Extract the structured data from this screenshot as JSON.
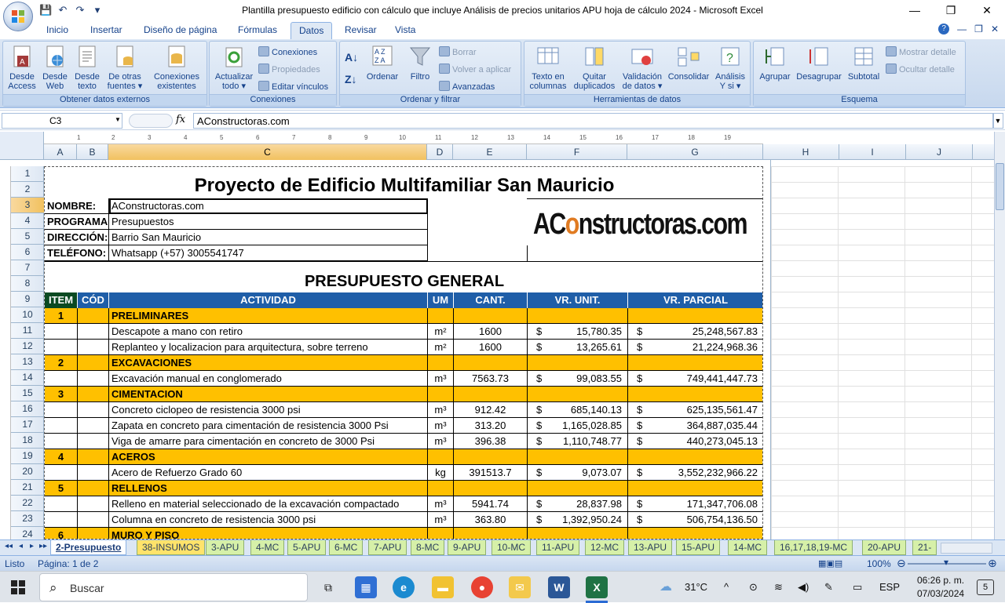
{
  "window": {
    "title": "Plantilla presupuesto edificio con cálculo que incluye Análisis de precios unitarios APU  hoja de cálculo 2024 - Microsoft Excel",
    "minimize": "—",
    "maximize": "❐",
    "close": "✕"
  },
  "qat": {
    "save": "💾",
    "undo": "↶",
    "redo": "↷",
    "more": "▾"
  },
  "tabs": [
    "Inicio",
    "Insertar",
    "Diseño de página",
    "Fórmulas",
    "Datos",
    "Revisar",
    "Vista"
  ],
  "tab_right": {
    "help": "?",
    "min": "—",
    "restore": "❐",
    "close": "✕"
  },
  "ribbon": {
    "g1": {
      "label": "Obtener datos externos",
      "b1": "Desde Access",
      "b1a": "Desde",
      "b1b": "Access",
      "b2a": "Desde",
      "b2b": "Web",
      "b3a": "Desde",
      "b3b": "texto",
      "b4a": "De otras",
      "b4b": "fuentes ▾",
      "b5a": "Conexiones",
      "b5b": "existentes"
    },
    "g2": {
      "label": "Conexiones",
      "b1a": "Actualizar",
      "b1b": "todo ▾",
      "s1": "Conexiones",
      "s2": "Propiedades",
      "s3": "Editar vínculos"
    },
    "g3": {
      "label": "Ordenar y filtrar",
      "b1": "Ordenar",
      "b2": "Filtro",
      "s1": "Borrar",
      "s2": "Volver a aplicar",
      "s3": "Avanzadas"
    },
    "g4": {
      "label": "Herramientas de datos",
      "b1a": "Texto en",
      "b1b": "columnas",
      "b2a": "Quitar",
      "b2b": "duplicados",
      "b3a": "Validación",
      "b3b": "de datos ▾",
      "b4": "Consolidar",
      "b5a": "Análisis",
      "b5b": "Y si ▾"
    },
    "g5": {
      "label": "Esquema",
      "b1": "Agrupar",
      "b2": "Desagrupar",
      "b3": "Subtotal",
      "s1": "Mostrar detalle",
      "s2": "Ocultar detalle"
    }
  },
  "formula": {
    "namebox": "C3",
    "fx": "fx",
    "content": "AConstructoras.com"
  },
  "columns": [
    "A",
    "B",
    "C",
    "D",
    "E",
    "F",
    "G",
    "H",
    "I",
    "J"
  ],
  "ruler": [
    "1",
    "2",
    "3",
    "4",
    "5",
    "6",
    "7",
    "8",
    "9",
    "10",
    "11",
    "12",
    "13",
    "14",
    "15",
    "16",
    "17",
    "18",
    "19"
  ],
  "rows": [
    "1",
    "2",
    "3",
    "4",
    "5",
    "6",
    "7",
    "8",
    "9",
    "10",
    "11",
    "12",
    "13",
    "14",
    "15",
    "16",
    "17",
    "18",
    "19",
    "20",
    "21",
    "22",
    "23",
    "24"
  ],
  "sheet": {
    "title": "Proyecto de Edificio Multifamiliar San Mauricio",
    "info": [
      {
        "label": "NOMBRE:",
        "value": "AConstructoras.com"
      },
      {
        "label": "PROGRAMA:",
        "value": "Presupuestos"
      },
      {
        "label": "DIRECCIÓN:",
        "value": "Barrio San Mauricio"
      },
      {
        "label": "TELÉFONO:",
        "value": "Whatsapp (+57) 3005541747"
      }
    ],
    "logo_a": "AC",
    "logo_b": "o",
    "logo_c": "nstructoras.com",
    "subtitle": "PRESUPUESTO GENERAL",
    "headers": [
      "ITEM",
      "CÓD",
      "ACTIVIDAD",
      "UM",
      "CANT.",
      "VR. UNIT.",
      "VR. PARCIAL"
    ],
    "lines": [
      {
        "type": "cat",
        "item": "1",
        "act": "PRELIMINARES"
      },
      {
        "type": "row",
        "act": "Descapote a mano con retiro",
        "um": "m²",
        "cant": "1600",
        "cur1": "$",
        "unit": "15,780.35",
        "cur2": "$",
        "parcial": "25,248,567.83"
      },
      {
        "type": "row",
        "act": " Replanteo y localizacion para arquitectura, sobre terreno",
        "um": "m²",
        "cant": "1600",
        "cur1": "$",
        "unit": "13,265.61",
        "cur2": "$",
        "parcial": "21,224,968.36"
      },
      {
        "type": "cat",
        "item": "2",
        "act": "EXCAVACIONES"
      },
      {
        "type": "row",
        "act": "Excavación manual en conglomerado",
        "um": "m³",
        "cant": "7563.73",
        "cur1": "$",
        "unit": "99,083.55",
        "cur2": "$",
        "parcial": "749,441,447.73"
      },
      {
        "type": "cat",
        "item": "3",
        "act": "CIMENTACION"
      },
      {
        "type": "row",
        "act": "Concreto ciclopeo de resistencia 3000 psi",
        "um": "m³",
        "cant": "912.42",
        "cur1": "$",
        "unit": "685,140.13",
        "cur2": "$",
        "parcial": "625,135,561.47"
      },
      {
        "type": "row",
        "act": "Zapata en concreto para cimentación de resistencia 3000 Psi",
        "um": "m³",
        "cant": "313.20",
        "cur1": "$",
        "unit": "1,165,028.85",
        "cur2": "$",
        "parcial": "364,887,035.44"
      },
      {
        "type": "row",
        "act": "Viga de amarre para cimentación en concreto de 3000 Psi",
        "um": "m³",
        "cant": "396.38",
        "cur1": "$",
        "unit": "1,110,748.77",
        "cur2": "$",
        "parcial": "440,273,045.13"
      },
      {
        "type": "cat",
        "item": "4",
        "act": "ACEROS"
      },
      {
        "type": "row",
        "act": "Acero de Refuerzo Grado 60",
        "um": "kg",
        "cant": "391513.7",
        "cur1": "$",
        "unit": "9,073.07",
        "cur2": "$",
        "parcial": "3,552,232,966.22"
      },
      {
        "type": "cat",
        "item": "5",
        "act": "RELLENOS"
      },
      {
        "type": "row",
        "act": "Relleno en material seleccionado de la excavación compactado",
        "um": "m³",
        "cant": "5941.74",
        "cur1": "$",
        "unit": "28,837.98",
        "cur2": "$",
        "parcial": "171,347,706.08"
      },
      {
        "type": "row",
        "act": "Columna en concreto de resistencia 3000 psi",
        "um": "m³",
        "cant": "363.80",
        "cur1": "$",
        "unit": "1,392,950.24",
        "cur2": "$",
        "parcial": "506,754,136.50"
      },
      {
        "type": "cat",
        "item": "6",
        "act": "MURO Y PISO"
      }
    ]
  },
  "sheettabs": [
    "2-Presupuesto",
    "38-INSUMOS",
    "3-APU",
    "4-MC",
    "5-APU",
    "6-MC",
    "7-APU",
    "8-MC",
    "9-APU",
    "10-MC",
    "11-APU",
    "12-MC",
    "13-APU",
    "15-APU",
    "14-MC",
    "16,17,18,19-MC",
    "20-APU",
    "21-"
  ],
  "nav": [
    "◂◂",
    "◂",
    "▸",
    "▸▸"
  ],
  "status": {
    "ready": "Listo",
    "page": "Página: 1 de 2",
    "zoom": "100%",
    "minus": "⊖",
    "plus": "⊕"
  },
  "taskbar": {
    "search": "Buscar",
    "temp": "31°C",
    "lang": "ESP",
    "time": "06:26 p. m.",
    "date": "07/03/2024",
    "notif": "5"
  }
}
